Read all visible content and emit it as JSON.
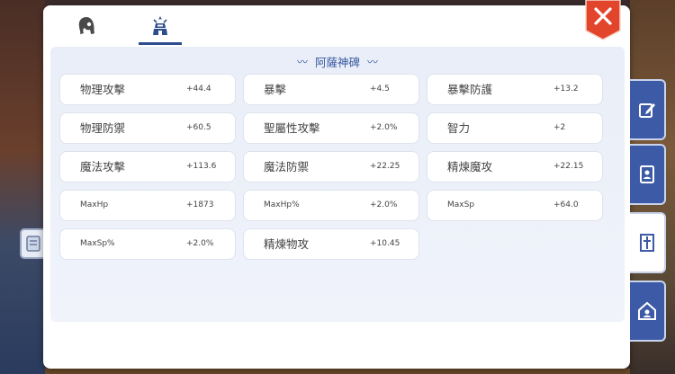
{
  "tabs": [
    {
      "icon": "character-head-icon"
    },
    {
      "icon": "emblem-icon",
      "active": true
    }
  ],
  "section": {
    "title": "阿薩神碑"
  },
  "stats": [
    {
      "label": "物理攻擊",
      "value": "+44.4"
    },
    {
      "label": "暴擊",
      "value": "+4.5"
    },
    {
      "label": "暴擊防護",
      "value": "+13.2"
    },
    {
      "label": "物理防禦",
      "value": "+60.5"
    },
    {
      "label": "聖屬性攻擊",
      "value": "+2.0%"
    },
    {
      "label": "智力",
      "value": "+2"
    },
    {
      "label": "魔法攻擊",
      "value": "+113.6"
    },
    {
      "label": "魔法防禦",
      "value": "+22.25"
    },
    {
      "label": "精煉魔攻",
      "value": "+22.15"
    },
    {
      "label": "MaxHp",
      "value": "+1873"
    },
    {
      "label": "MaxHp%",
      "value": "+2.0%"
    },
    {
      "label": "MaxSp",
      "value": "+64.0"
    },
    {
      "label": "MaxSp%",
      "value": "+2.0%"
    },
    {
      "label": "精煉物攻",
      "value": "+10.45"
    }
  ],
  "colors": {
    "accent": "#3d5aa6",
    "close": "#e2452c",
    "title": "#3a5aa0"
  },
  "side_tabs": [
    {
      "icon": "edit-icon"
    },
    {
      "icon": "card-album-icon"
    },
    {
      "icon": "rune-tablet-icon",
      "active": true
    },
    {
      "icon": "guild-house-icon"
    }
  ],
  "close": {
    "icon": "close-icon"
  }
}
